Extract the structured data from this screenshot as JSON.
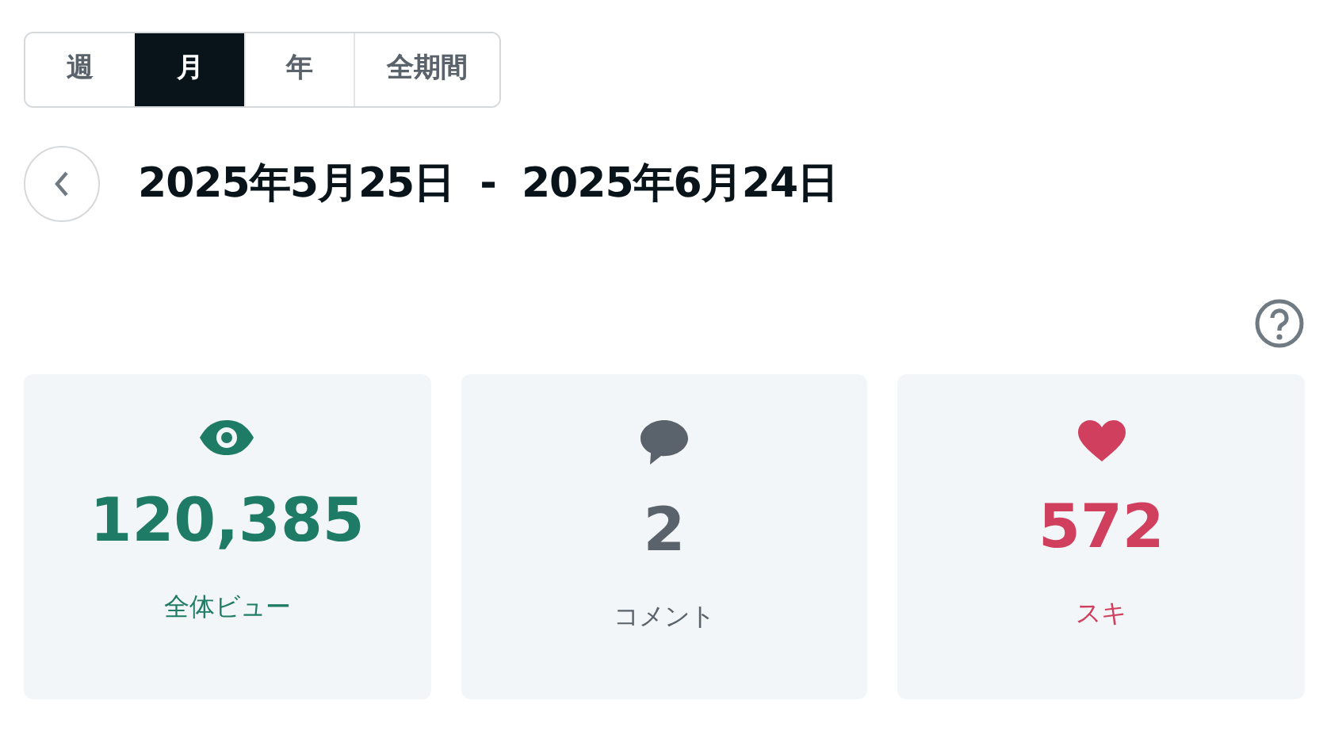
{
  "period_tabs": [
    {
      "label": "週",
      "selected": false
    },
    {
      "label": "月",
      "selected": true
    },
    {
      "label": "年",
      "selected": false
    },
    {
      "label": "全期間",
      "selected": false
    }
  ],
  "date_range": {
    "start": "2025年5月25日",
    "separator": "-",
    "end": "2025年6月24日"
  },
  "stats": [
    {
      "kind": "views",
      "value": "120,385",
      "label": "全体ビュー",
      "color": "#1e7b65"
    },
    {
      "kind": "comments",
      "value": "2",
      "label": "コメント",
      "color": "#5a636b"
    },
    {
      "kind": "likes",
      "value": "572",
      "label": "スキ",
      "color": "#d0405e"
    }
  ]
}
